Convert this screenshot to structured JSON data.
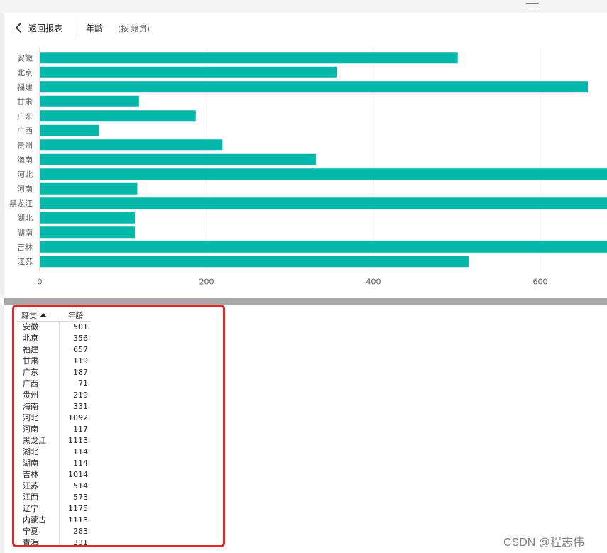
{
  "toolbar": {
    "back_label": "返回报表",
    "visual_title": "年龄",
    "visual_subtitle": "(按 籍贯)"
  },
  "colors": {
    "bar": "#01b8aa",
    "highlight_border": "#e8242a"
  },
  "chart_data": {
    "type": "bar",
    "orientation": "horizontal",
    "categories": [
      "安徽",
      "北京",
      "福建",
      "甘肃",
      "广东",
      "广西",
      "贵州",
      "海南",
      "河北",
      "河南",
      "黑龙江",
      "湖北",
      "湖南",
      "吉林",
      "江苏"
    ],
    "values": [
      501,
      356,
      657,
      119,
      187,
      71,
      219,
      331,
      1092,
      117,
      1113,
      114,
      114,
      1014,
      514
    ],
    "x_ticks": [
      0,
      200,
      400,
      600
    ],
    "x_visible_range": [
      0,
      679
    ],
    "grid": true,
    "xlabel": "",
    "ylabel": ""
  },
  "table": {
    "headers": [
      "籍贯",
      "年龄"
    ],
    "sorted_column": 0,
    "rows": [
      {
        "province": "安徽",
        "age": "501"
      },
      {
        "province": "北京",
        "age": "356"
      },
      {
        "province": "福建",
        "age": "657"
      },
      {
        "province": "甘肃",
        "age": "119"
      },
      {
        "province": "广东",
        "age": "187"
      },
      {
        "province": "广西",
        "age": "71"
      },
      {
        "province": "贵州",
        "age": "219"
      },
      {
        "province": "海南",
        "age": "331"
      },
      {
        "province": "河北",
        "age": "1092"
      },
      {
        "province": "河南",
        "age": "117"
      },
      {
        "province": "黑龙江",
        "age": "1113"
      },
      {
        "province": "湖北",
        "age": "114"
      },
      {
        "province": "湖南",
        "age": "114"
      },
      {
        "province": "吉林",
        "age": "1014"
      },
      {
        "province": "江苏",
        "age": "514"
      },
      {
        "province": "江西",
        "age": "573"
      },
      {
        "province": "辽宁",
        "age": "1175"
      },
      {
        "province": "内蒙古",
        "age": "1113"
      },
      {
        "province": "宁夏",
        "age": "283"
      },
      {
        "province": "青海",
        "age": "331"
      }
    ]
  },
  "watermark": "CSDN @程志伟"
}
